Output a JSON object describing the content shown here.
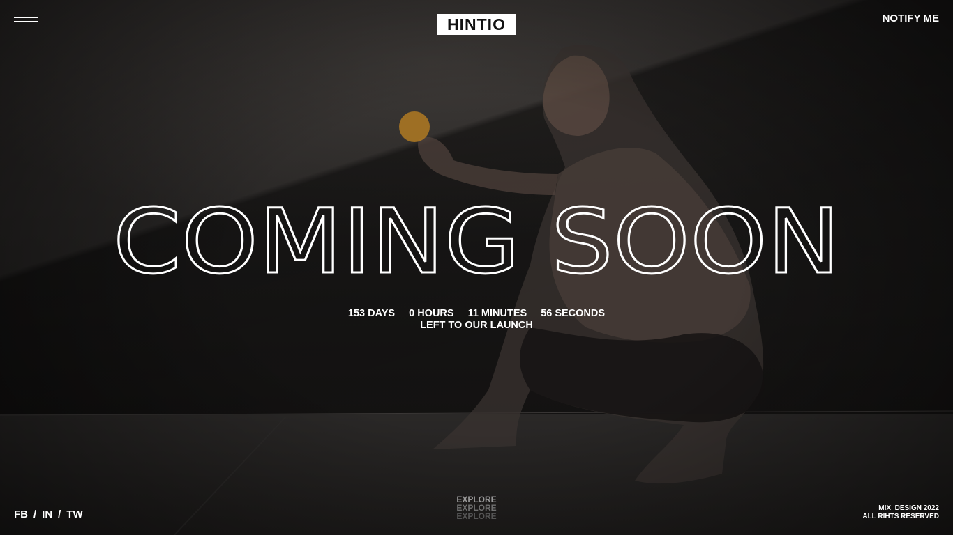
{
  "header": {
    "brand": "HINTIO",
    "notify_label": "NOTIFY ME",
    "menu_icon": "hamburger-menu-icon"
  },
  "hero": {
    "headline": "COMING SOON",
    "countdown": {
      "days": "153 DAYS",
      "hours": "0 HOURS",
      "minutes": "11 MINUTES",
      "seconds": "56 SECONDS",
      "caption": "LEFT TO OUR LAUNCH"
    }
  },
  "footer": {
    "social": [
      {
        "label": "FB"
      },
      {
        "label": "IN"
      },
      {
        "label": "TW"
      }
    ],
    "separator": "/",
    "explore": [
      "EXPLORE",
      "EXPLORE",
      "EXPLORE"
    ],
    "credit": "MIX_DESIGN 2022",
    "rights": "ALL RIHTS RESERVED"
  },
  "colors": {
    "background": "#1c1b1b",
    "text": "#ffffff",
    "logo_bg": "#ffffff",
    "logo_text": "#111111"
  }
}
